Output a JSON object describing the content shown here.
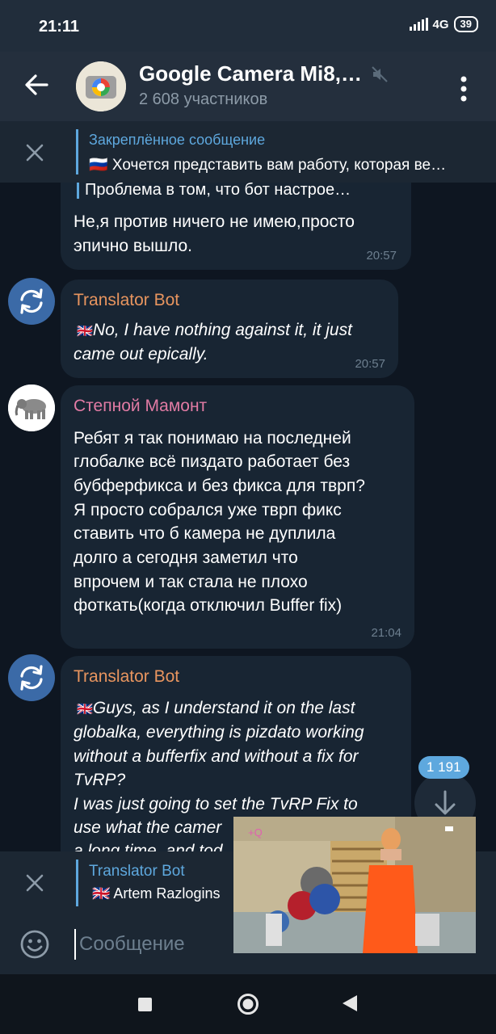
{
  "status_bar": {
    "time": "21:11",
    "network": "4G",
    "battery": "39"
  },
  "header": {
    "title": "Google Camera Mi8,…",
    "members": "2 608 участников",
    "icons": [
      "back-arrow-icon",
      "google-camera-icon",
      "mute-icon",
      "more-vert-icon"
    ]
  },
  "pinned": {
    "title": "Закреплённое сообщение",
    "text": "🇷🇺 Хочется представить вам работу, которая ве…"
  },
  "messages": [
    {
      "quote": "Проблема в том, что бот настрое…",
      "lines": [
        "Не,я против ничего не имею,просто",
        "эпично вышло."
      ],
      "time": "20:57"
    },
    {
      "author": "Translator Bot",
      "author_color": "#e8955f",
      "flag": "🇬🇧",
      "lines": [
        "No, I have nothing against it, it just",
        "came out epically."
      ],
      "time": "20:57"
    },
    {
      "author": "Степной Мамонт",
      "author_color": "#e17ba4",
      "lines": [
        "Ребят я так понимаю на последней",
        "глобалке всё пиздато работает  без",
        "бубферфикса и без  фикса для тврп?",
        "Я просто собрался уже тврп фикс",
        "ставить что б камера не дуплила",
        "долго а сегодня заметил что",
        "впрочем и так стала не плохо",
        "фоткать(когда отключил Buffer fix)"
      ],
      "time": "21:04"
    },
    {
      "author": "Translator Bot",
      "author_color": "#e8955f",
      "flag": "🇬🇧",
      "lines": [
        "Guys, as I understand it on the last",
        "globalka, everything is pizdato working",
        "without a bufferfix and without a fix for",
        "TvRP?",
        "I was just going to set the TvRP Fix to",
        "use what the camer",
        "a long time, and tod"
      ]
    }
  ],
  "unread_count": "1 191",
  "reply": {
    "author": "Translator Bot",
    "text": "🇬🇧 Artem Razlogins"
  },
  "input": {
    "placeholder": "Сообщение"
  },
  "colors": {
    "background": "#0e1621",
    "header": "#242f3d",
    "bubble": "#182533",
    "accent": "#5ea8de"
  }
}
